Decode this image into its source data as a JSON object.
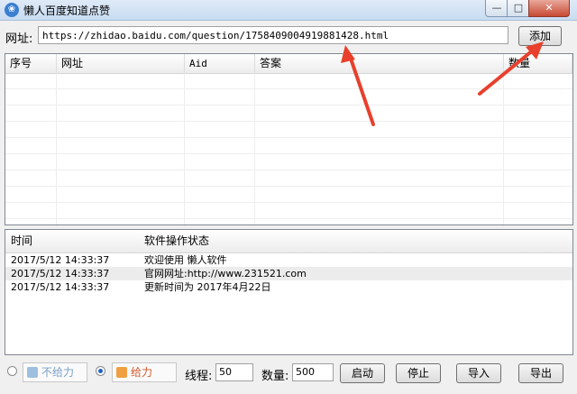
{
  "window": {
    "title": "懒人百度知道点赞",
    "app_icon": "paw-icon",
    "controls": {
      "minimize": "—",
      "maximize": "□",
      "close": "✕"
    }
  },
  "url_bar": {
    "label": "网址:",
    "value": "https://zhidao.baidu.com/question/1758409004919881428.html",
    "add_label": "添加"
  },
  "task_table": {
    "columns": [
      "序号",
      "网址",
      "Aid",
      "答案",
      "数量"
    ],
    "rows": []
  },
  "log_table": {
    "columns": [
      "时间",
      "软件操作状态"
    ],
    "rows": [
      {
        "time": "2017/5/12 14:33:37",
        "status": "欢迎使用  懒人软件"
      },
      {
        "time": "2017/5/12 14:33:37",
        "status": "官网网址:http://www.231521.com"
      },
      {
        "time": "2017/5/12 14:33:37",
        "status": "更新时间为   2017年4月22日"
      }
    ]
  },
  "controls": {
    "option_dislike": {
      "label": "不给力",
      "icon": "thumbs-down-icon",
      "selected": false
    },
    "option_like": {
      "label": "给力",
      "icon": "thumbs-up-icon",
      "selected": true
    },
    "threads_label": "线程:",
    "threads_value": "50",
    "count_label": "数量:",
    "count_value": "500",
    "start": "启动",
    "stop": "停止",
    "import": "导入",
    "export": "导出"
  },
  "colors": {
    "arrow": "#e8402c",
    "accent": "#1f64c4"
  }
}
